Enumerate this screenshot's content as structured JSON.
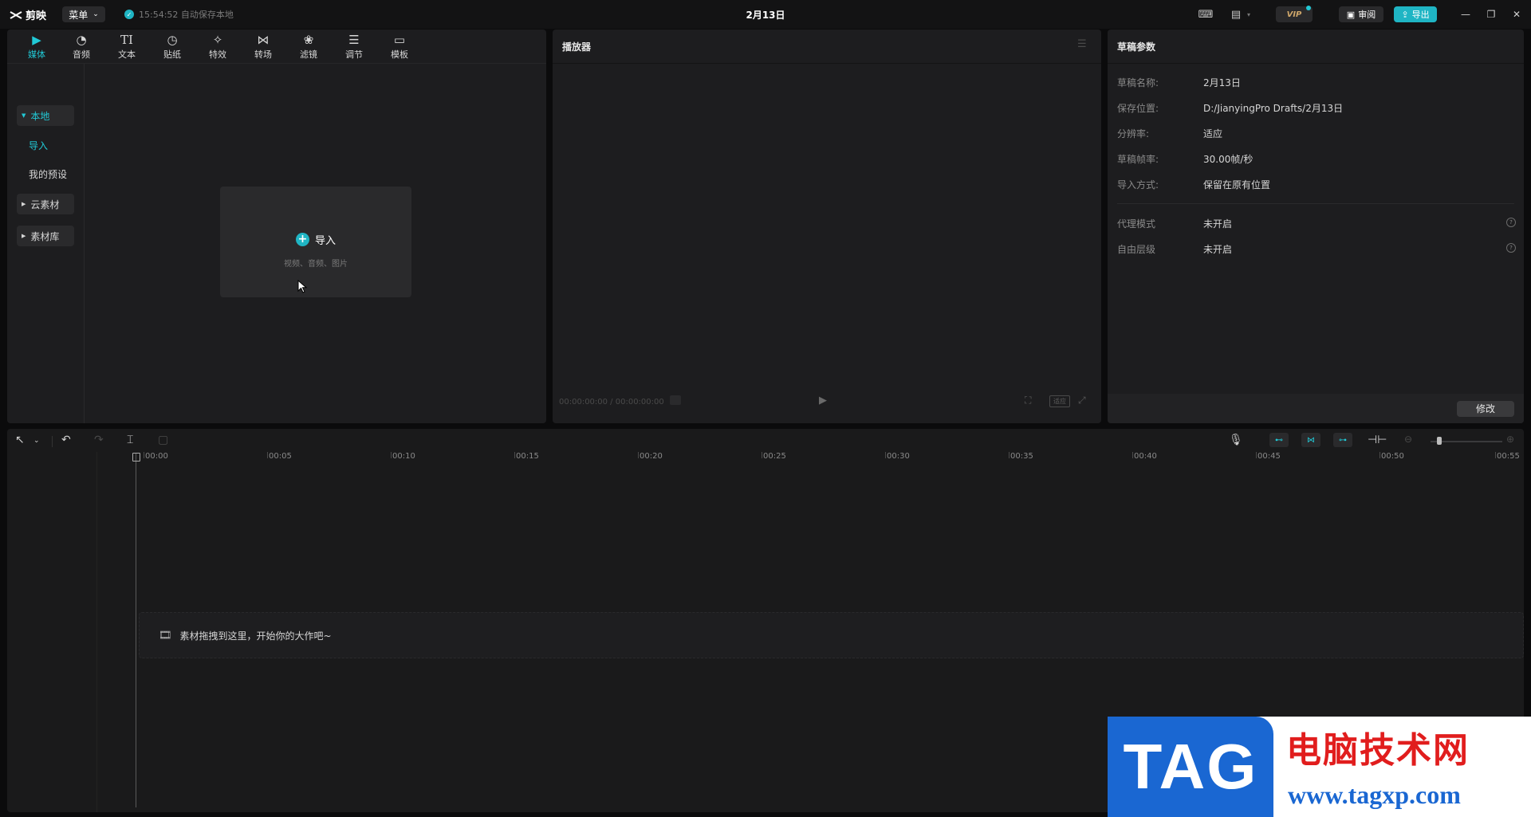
{
  "titlebar": {
    "app_name": "剪映",
    "menu_label": "菜单",
    "save_status": "15:54:52 自动保存本地",
    "project_title": "2月13日",
    "vip_label": "VIP",
    "review_label": "审阅",
    "export_label": "导出"
  },
  "media": {
    "tools": [
      {
        "label": "媒体",
        "icon": "media-icon"
      },
      {
        "label": "音频",
        "icon": "audio-icon"
      },
      {
        "label": "文本",
        "icon": "text-icon"
      },
      {
        "label": "贴纸",
        "icon": "sticker-icon"
      },
      {
        "label": "特效",
        "icon": "effects-icon"
      },
      {
        "label": "转场",
        "icon": "transition-icon"
      },
      {
        "label": "滤镜",
        "icon": "filter-icon"
      },
      {
        "label": "调节",
        "icon": "adjust-icon"
      },
      {
        "label": "模板",
        "icon": "template-icon"
      }
    ],
    "sidebar": {
      "local": "本地",
      "import": "导入",
      "presets": "我的预设",
      "cloud": "云素材",
      "library": "素材库"
    },
    "import_box": {
      "label": "导入",
      "sub": "视频、音频、图片"
    }
  },
  "player": {
    "title": "播放器",
    "timecode": "00:00:00:00 / 00:00:00:00",
    "ratio_label": "适应"
  },
  "draft": {
    "title": "草稿参数",
    "params": [
      {
        "label": "草稿名称:",
        "value": "2月13日"
      },
      {
        "label": "保存位置:",
        "value": "D:/JianyingPro Drafts/2月13日"
      },
      {
        "label": "分辨率:",
        "value": "适应"
      },
      {
        "label": "草稿帧率:",
        "value": "30.00帧/秒"
      },
      {
        "label": "导入方式:",
        "value": "保留在原有位置"
      }
    ],
    "modes": [
      {
        "label": "代理模式",
        "value": "未开启"
      },
      {
        "label": "自由层级",
        "value": "未开启"
      }
    ],
    "edit_label": "修改"
  },
  "timeline": {
    "ruler": [
      "00:00",
      "00:05",
      "00:10",
      "00:15",
      "00:20",
      "00:25",
      "00:30",
      "00:35",
      "00:40",
      "00:45",
      "00:50",
      "00:55"
    ],
    "track_hint": "素材拖拽到这里，开始你的大作吧~"
  },
  "watermark": {
    "tag": "TAG",
    "cn": "电脑技术网",
    "url": "www.tagxp.com"
  },
  "colors": {
    "accent": "#1fb5c4",
    "panel": "#1d1d1f",
    "background": "#0b0b0c"
  }
}
